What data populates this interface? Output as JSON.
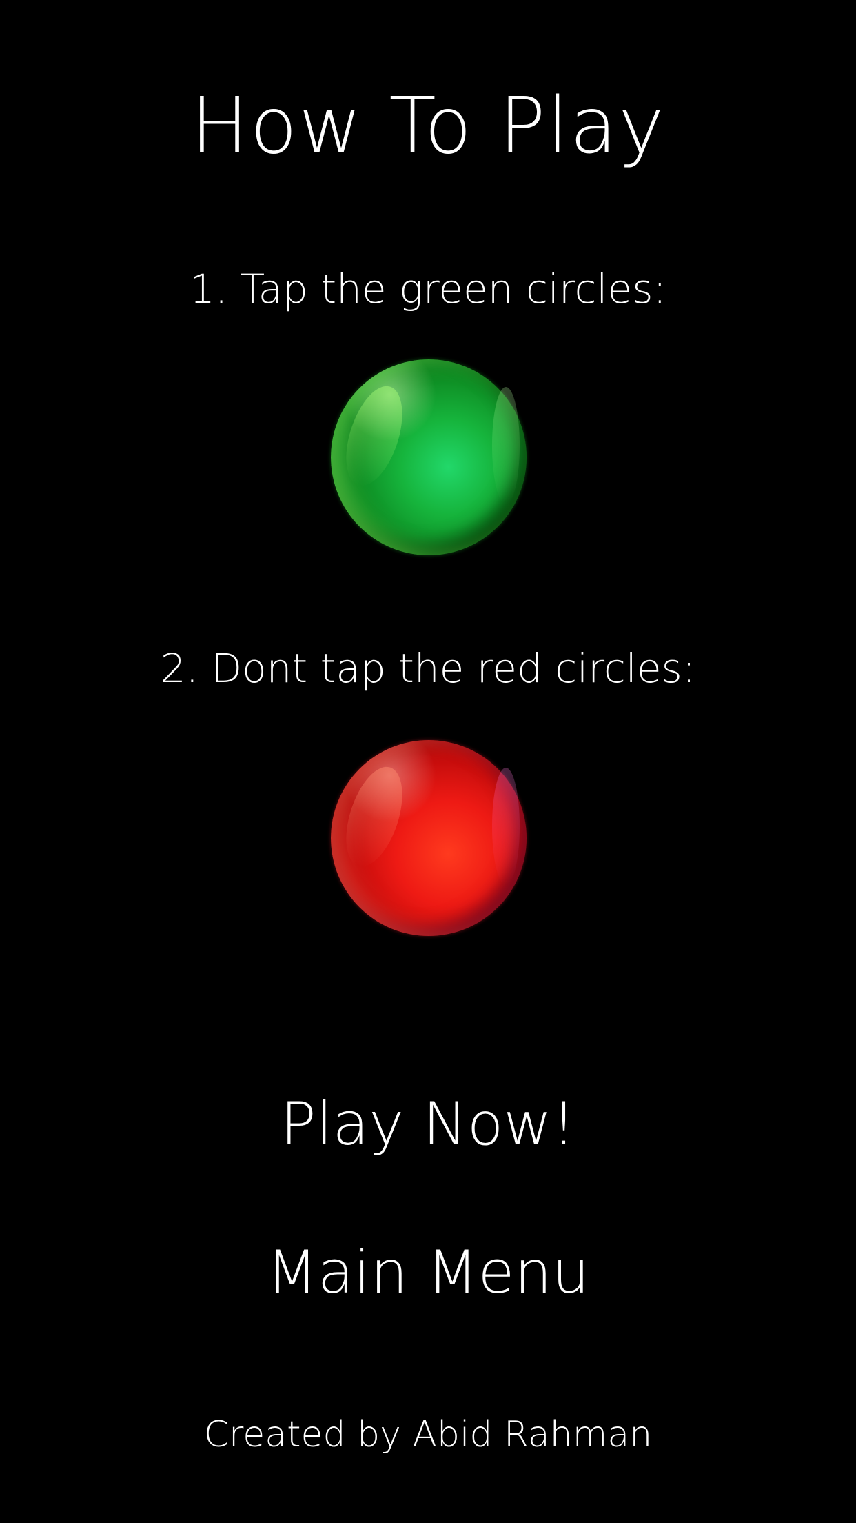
{
  "screen": {
    "title": "How To Play",
    "instructions": [
      {
        "text": "1. Tap the green circles:",
        "orb_color": "#1ec85a",
        "orb_icon": "green-circle-icon"
      },
      {
        "text": "2. Dont tap the red circles:",
        "orb_color": "#f0201a",
        "orb_icon": "red-circle-icon"
      }
    ],
    "buttons": {
      "play_now": "Play Now!",
      "main_menu": "Main Menu"
    },
    "credit": "Created by Abid Rahman",
    "colors": {
      "background": "#000000",
      "text": "#ffffff"
    }
  }
}
